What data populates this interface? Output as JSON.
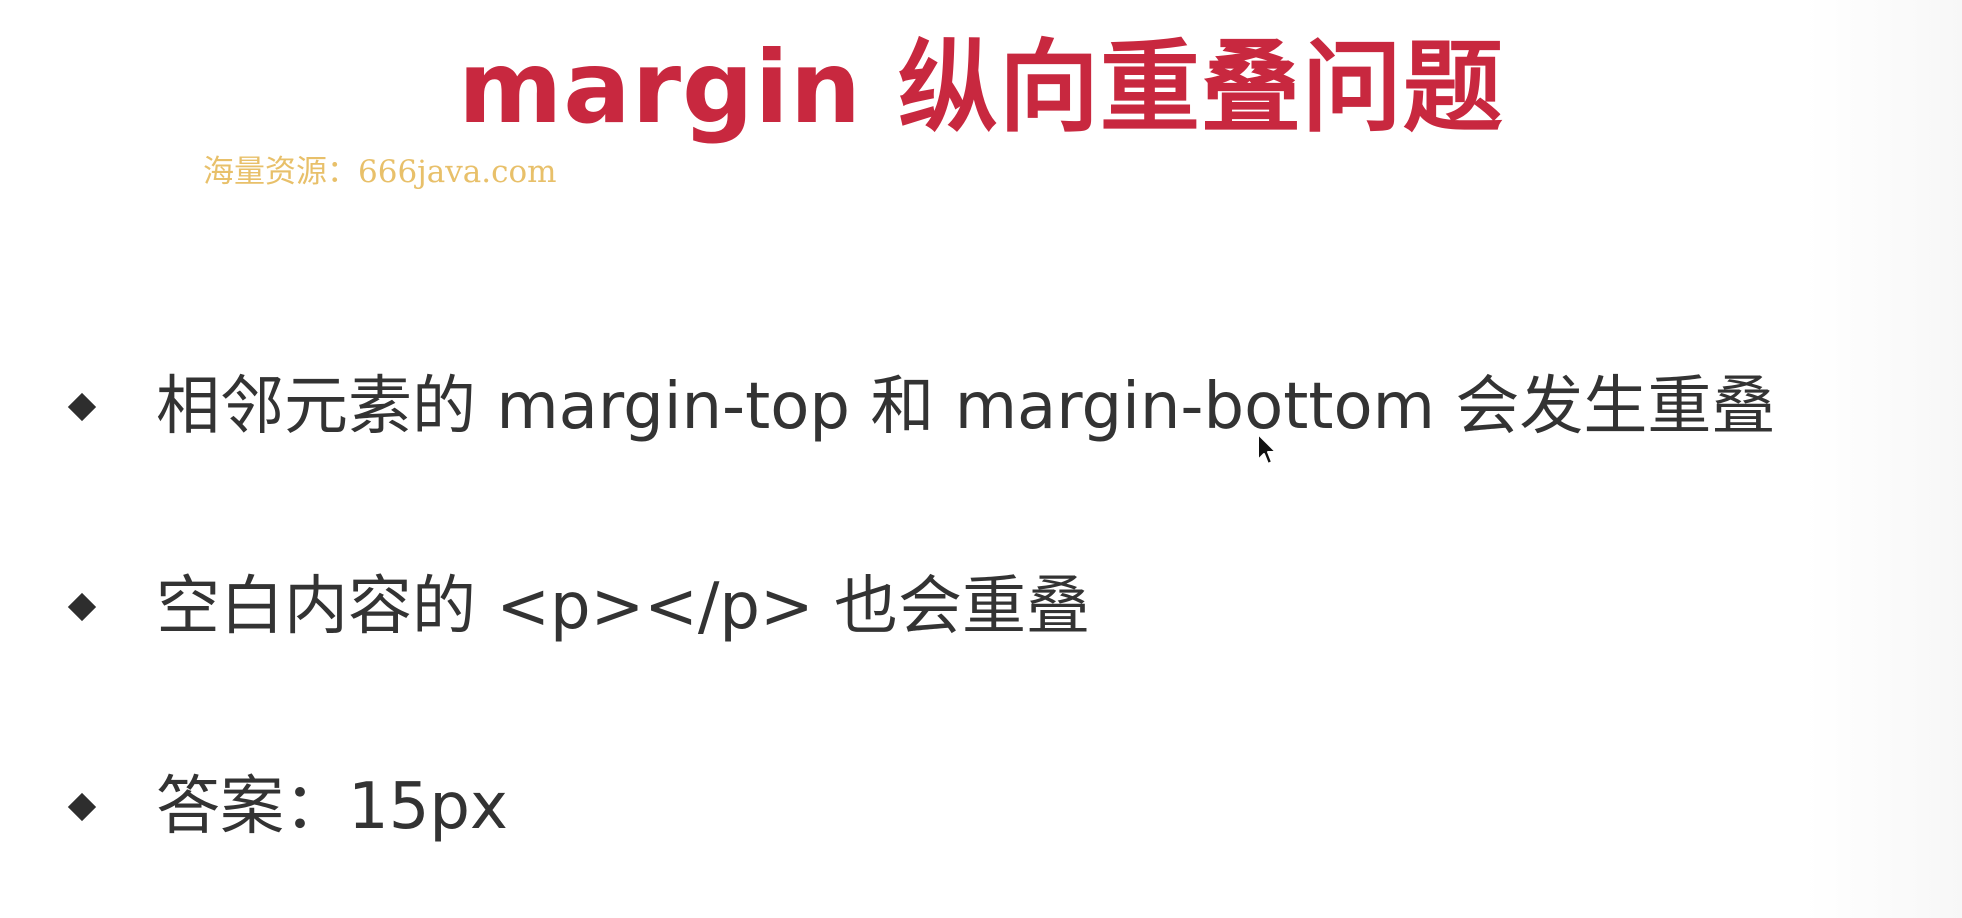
{
  "slide": {
    "title": "margin 纵向重叠问题",
    "watermark": "海量资源：666java.com",
    "bullets": [
      {
        "text": "相邻元素的 margin-top 和 margin-bottom 会发生重叠"
      },
      {
        "text": "空白内容的 <p></p> 也会重叠"
      },
      {
        "text": "答案：15px"
      }
    ]
  },
  "colors": {
    "title": "#c8283f",
    "body_text": "#333333",
    "watermark": "#e8c06a",
    "bullet_marker": "#2e2e2e",
    "background": "#ffffff"
  },
  "icons": {
    "bullet_marker": "diamond-icon",
    "pointer": "mouse-cursor-icon"
  }
}
